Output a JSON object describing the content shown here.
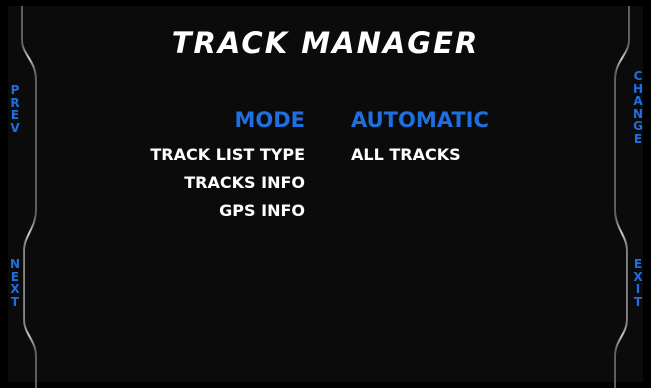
{
  "screen": {
    "title": "TRACK MANAGER"
  },
  "menu": {
    "rows": [
      {
        "label": "MODE",
        "value": "AUTOMATIC",
        "highlighted": true
      },
      {
        "label": "TRACK LIST TYPE",
        "value": "ALL TRACKS",
        "highlighted": false
      },
      {
        "label": "TRACKS INFO",
        "value": "",
        "highlighted": false
      },
      {
        "label": "GPS INFO",
        "value": "",
        "highlighted": false
      }
    ]
  },
  "soft_keys": {
    "left_top": "PREV",
    "left_bottom": "NEXT",
    "right_top": "CHANGE",
    "right_bottom": "EXIT"
  },
  "colors": {
    "background": "#000000",
    "highlight": "#1f6fe0",
    "text": "#ffffff",
    "bezel": "#8a8a8a"
  }
}
